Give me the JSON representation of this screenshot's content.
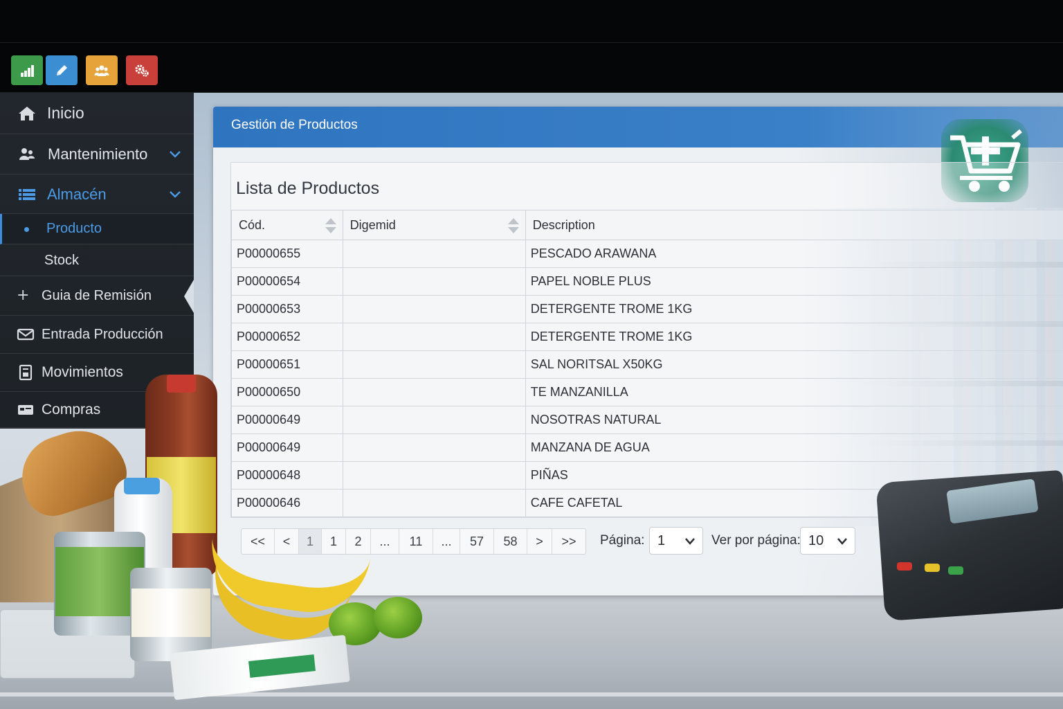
{
  "toolbar": {
    "buttons": [
      {
        "icon": "bar-chart-icon",
        "color": "#3d9a4b"
      },
      {
        "icon": "pencil-icon",
        "color": "#3b8ed2"
      },
      {
        "icon": "users-icon",
        "color": "#e6a33a"
      },
      {
        "icon": "gears-icon",
        "color": "#c9403b"
      }
    ]
  },
  "sidebar": {
    "items": [
      {
        "label": "Inicio",
        "icon": "home-icon"
      },
      {
        "label": "Mantenimiento",
        "icon": "users-icon",
        "expandable": true
      },
      {
        "label": "Almacén",
        "icon": "list-icon",
        "expandable": true,
        "active": true
      },
      {
        "label": "Producto",
        "active": true
      },
      {
        "label": "Stock"
      },
      {
        "label": "Guia de Remisión",
        "icon": "plus-icon"
      },
      {
        "label": "Entrada Producción",
        "icon": "envelope-icon"
      },
      {
        "label": "Movimientos",
        "icon": "document-icon"
      },
      {
        "label": "Compras",
        "icon": "card-icon"
      }
    ],
    "accent_color": "#4b9be6"
  },
  "panel": {
    "title": "Gestión de Productos",
    "header_color": "#2f74bf",
    "list_title": "Lista de Productos"
  },
  "table": {
    "columns": [
      "Cód.",
      "Digemid",
      "Description"
    ],
    "rows": [
      {
        "code": "P00000655",
        "digemid": "",
        "description": "PESCADO ARAWANA"
      },
      {
        "code": "P00000654",
        "digemid": "",
        "description": "PAPEL NOBLE PLUS"
      },
      {
        "code": "P00000653",
        "digemid": "",
        "description": "DETERGENTE TROME 1KG"
      },
      {
        "code": "P00000652",
        "digemid": "",
        "description": "DETERGENTE TROME 1KG"
      },
      {
        "code": "P00000651",
        "digemid": "",
        "description": "SAL NORITSAL X50KG"
      },
      {
        "code": "P00000650",
        "digemid": "",
        "description": "TE MANZANILLA"
      },
      {
        "code": "P00000649",
        "digemid": "",
        "description": "NOSOTRAS NATURAL"
      },
      {
        "code": "P00000649",
        "digemid": "",
        "description": "MANZANA DE AGUA"
      },
      {
        "code": "P00000648",
        "digemid": "",
        "description": "PIÑAS"
      },
      {
        "code": "P00000646",
        "digemid": "",
        "description": "CAFE CAFETAL"
      }
    ]
  },
  "pagination": {
    "pages": [
      "<<",
      "<",
      "1",
      "1",
      "2",
      "...",
      "11",
      "...",
      "57",
      "58",
      ">",
      ">>"
    ],
    "active_index": 2,
    "page_label": "Página:",
    "page_value": "1",
    "per_page_label": "Ver por página:",
    "per_page_value": "10"
  }
}
